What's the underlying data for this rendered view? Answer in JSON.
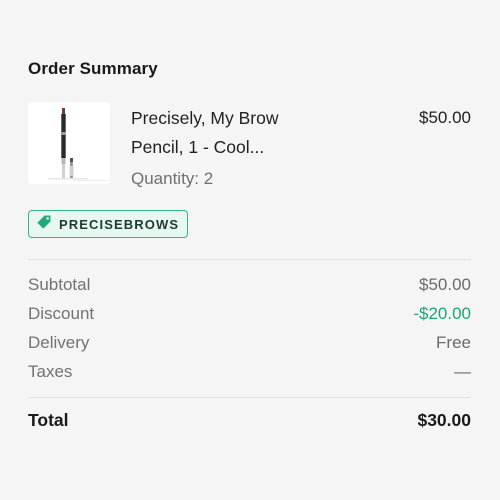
{
  "title": "Order Summary",
  "item": {
    "name": "Precisely, My Brow Pencil, 1 - Cool...",
    "price": "$50.00",
    "quantity": "Quantity: 2"
  },
  "promo": {
    "code": "PRECISEBROWS",
    "icon": "tag-icon",
    "color": "#2fb58a"
  },
  "totals": {
    "subtotal_label": "Subtotal",
    "subtotal_value": "$50.00",
    "discount_label": "Discount",
    "discount_value": "-$20.00",
    "delivery_label": "Delivery",
    "delivery_value": "Free",
    "taxes_label": "Taxes",
    "taxes_value": "—",
    "total_label": "Total",
    "total_value": "$30.00"
  },
  "colors": {
    "discount": "#19a678",
    "background": "#f5f5f6"
  }
}
